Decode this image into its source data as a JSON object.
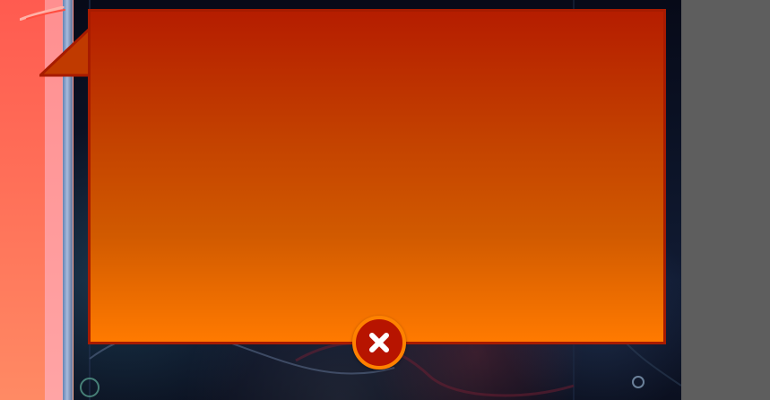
{
  "colors": {
    "background_gray": "#5e5e5e",
    "panel_top": "#b51d00",
    "panel_bottom": "#ff7a00",
    "panel_border": "#a71b00",
    "close_fill": "#b71400",
    "close_ring": "#ff8200",
    "left_panel_coral": "#ff6f58",
    "left_panel_pink": "#ffa4a5",
    "left_panel_rail": "#8ea5ca"
  },
  "icons": {
    "close": "close-icon"
  }
}
